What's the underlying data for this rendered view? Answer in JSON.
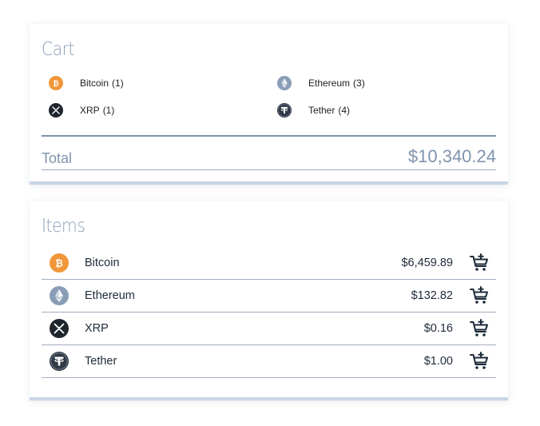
{
  "cart": {
    "title": "Cart",
    "entries": [
      {
        "name": "Bitcoin",
        "qty": "(1)",
        "icon": "bitcoin-icon"
      },
      {
        "name": "Ethereum",
        "qty": "(3)",
        "icon": "ethereum-icon"
      },
      {
        "name": "XRP",
        "qty": "(1)",
        "icon": "xrp-icon"
      },
      {
        "name": "Tether",
        "qty": "(4)",
        "icon": "tether-icon"
      }
    ],
    "total_label": "Total",
    "total_value": "$10,340.24"
  },
  "items": {
    "title": "Items",
    "rows": [
      {
        "name": "Bitcoin",
        "price": "$6,459.89",
        "icon": "bitcoin-icon"
      },
      {
        "name": "Ethereum",
        "price": "$132.82",
        "icon": "ethereum-icon"
      },
      {
        "name": "XRP",
        "price": "$0.16",
        "icon": "xrp-icon"
      },
      {
        "name": "Tether",
        "price": "$1.00",
        "icon": "tether-icon"
      }
    ]
  },
  "colors": {
    "bitcoin": "#f0973a",
    "ethereum": "#8a9db6",
    "xrp": "#1f252d",
    "tether": "#2f3846",
    "accent": "#8a9db7",
    "bar": "#c9d5e3"
  }
}
